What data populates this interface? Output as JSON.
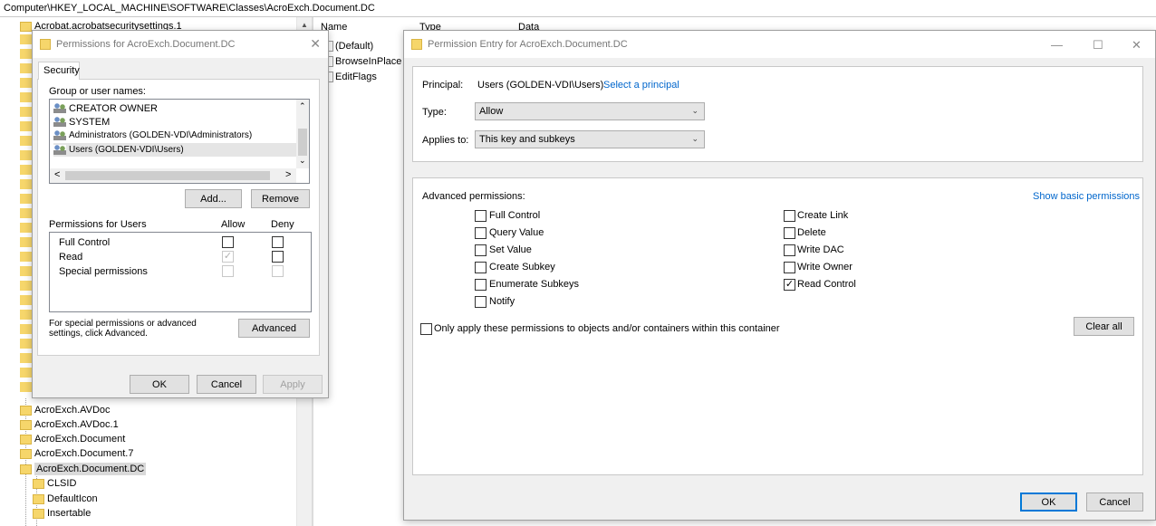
{
  "registry": {
    "address": "Computer\\HKEY_LOCAL_MACHINE\\SOFTWARE\\Classes\\AcroExch.Document.DC",
    "tree_top": "Acrobat.acrobatsecuritysettings.1",
    "tree_items": [
      "AcroExch.AVDoc",
      "AcroExch.AVDoc.1",
      "AcroExch.Document",
      "AcroExch.Document.7",
      "AcroExch.Document.DC"
    ],
    "tree_children": [
      "CLSID",
      "DefaultIcon",
      "Insertable"
    ],
    "columns": {
      "name": "Name",
      "type": "Type",
      "data": "Data"
    },
    "values": [
      "(Default)",
      "BrowseInPlace",
      "EditFlags"
    ]
  },
  "perm_dialog": {
    "title": "Permissions for AcroExch.Document.DC",
    "tab": "Security",
    "group_label": "Group or user names:",
    "users": [
      "CREATOR OWNER",
      "SYSTEM",
      "Administrators (GOLDEN-VDI\\Administrators)",
      "Users (GOLDEN-VDI\\Users)"
    ],
    "add": "Add...",
    "remove": "Remove",
    "perms_for": "Permissions for Users",
    "allow": "Allow",
    "deny": "Deny",
    "perms": [
      "Full Control",
      "Read",
      "Special permissions"
    ],
    "special_note": "For special permissions or advanced settings, click Advanced.",
    "advanced": "Advanced",
    "ok": "OK",
    "cancel": "Cancel",
    "apply": "Apply"
  },
  "entry_dialog": {
    "title": "Permission Entry for AcroExch.Document.DC",
    "principal_label": "Principal:",
    "principal_value": "Users (GOLDEN-VDI\\Users)",
    "select_principal": "Select a principal",
    "type_label": "Type:",
    "type_value": "Allow",
    "applies_label": "Applies to:",
    "applies_value": "This key and subkeys",
    "adv_label": "Advanced permissions:",
    "show_basic": "Show basic permissions",
    "left_perms": [
      "Full Control",
      "Query Value",
      "Set Value",
      "Create Subkey",
      "Enumerate Subkeys",
      "Notify"
    ],
    "right_perms": [
      "Create Link",
      "Delete",
      "Write DAC",
      "Write Owner",
      "Read Control"
    ],
    "only_apply": "Only apply these permissions to objects and/or containers within this container",
    "clear_all": "Clear all",
    "ok": "OK",
    "cancel": "Cancel"
  }
}
